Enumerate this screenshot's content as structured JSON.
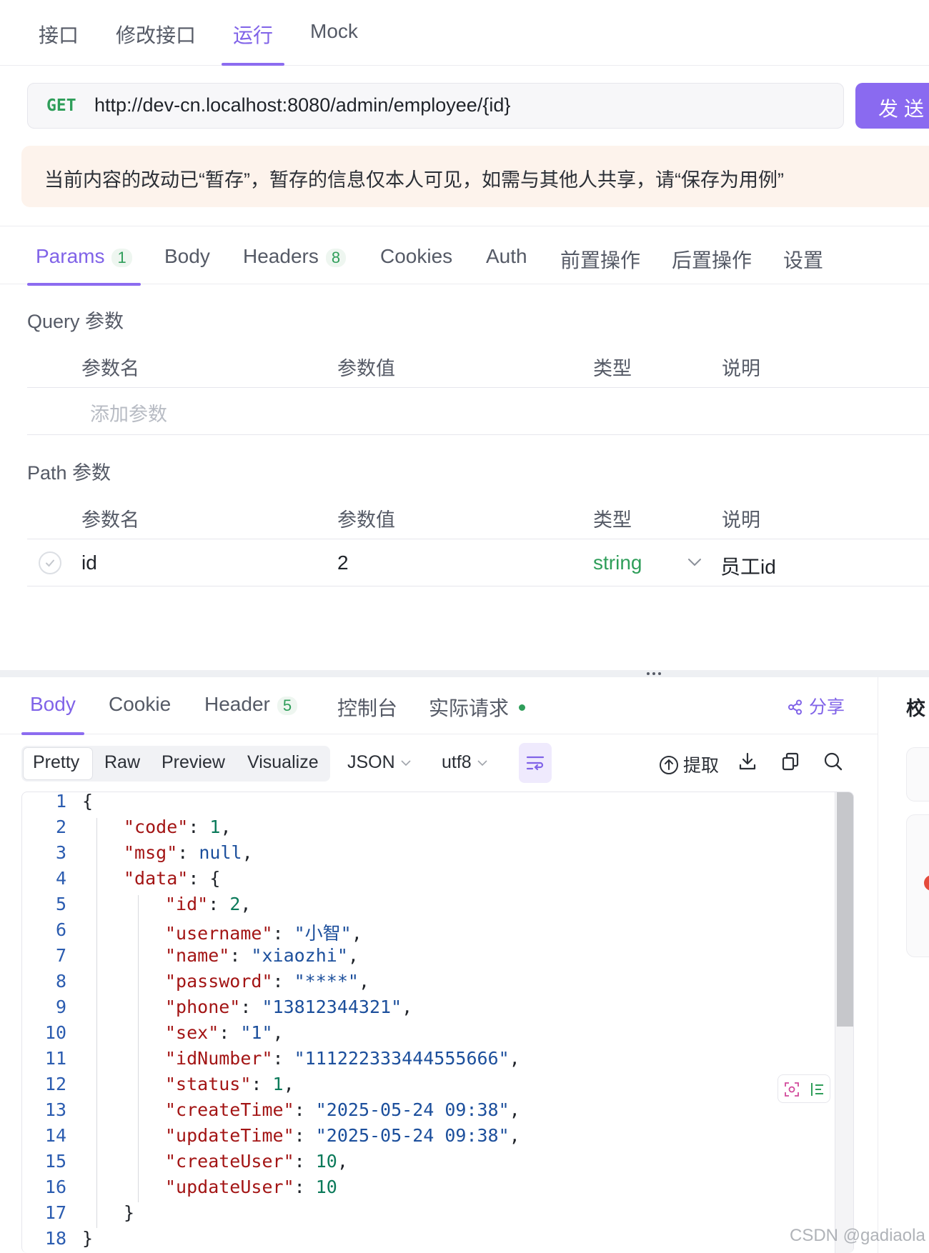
{
  "top_tabs": [
    {
      "label": "接口"
    },
    {
      "label": "修改接口"
    },
    {
      "label": "运行"
    },
    {
      "label": "Mock"
    }
  ],
  "request": {
    "method": "GET",
    "url": "http://dev-cn.localhost:8080/admin/employee/{id}",
    "send_label": "发送"
  },
  "notice": "当前内容的改动已“暂存”，暂存的信息仅本人可见，如需与其他人共享，请“保存为用例”",
  "request_tabs": [
    {
      "label": "Params",
      "count": "1"
    },
    {
      "label": "Body"
    },
    {
      "label": "Headers",
      "count": "8"
    },
    {
      "label": "Cookies"
    },
    {
      "label": "Auth"
    },
    {
      "label": "前置操作"
    },
    {
      "label": "后置操作"
    },
    {
      "label": "设置"
    }
  ],
  "query_section": {
    "title": "Query 参数",
    "columns": [
      "参数名",
      "参数值",
      "类型",
      "说明"
    ],
    "placeholder": "添加参数"
  },
  "path_section": {
    "title": "Path 参数",
    "columns": [
      "参数名",
      "参数值",
      "类型",
      "说明"
    ],
    "rows": [
      {
        "name": "id",
        "value": "2",
        "type": "string",
        "desc": "员工id"
      }
    ]
  },
  "response_tabs": [
    {
      "label": "Body"
    },
    {
      "label": "Cookie"
    },
    {
      "label": "Header",
      "count": "5"
    },
    {
      "label": "控制台"
    },
    {
      "label": "实际请求"
    }
  ],
  "share_label": "分享",
  "right_panel_label": "校",
  "toolbar": {
    "view_modes": [
      "Pretty",
      "Raw",
      "Preview",
      "Visualize"
    ],
    "format": "JSON",
    "encoding": "utf8",
    "extract_label": "提取"
  },
  "code_lines": [
    {
      "n": "1",
      "text": "{"
    },
    {
      "n": "2",
      "key": "code",
      "value": "1",
      "vtype": "number",
      "comma": ","
    },
    {
      "n": "3",
      "key": "msg",
      "value": "null",
      "vtype": "null",
      "comma": ","
    },
    {
      "n": "4",
      "key": "data",
      "value": "{",
      "vtype": "brace",
      "comma": ""
    },
    {
      "n": "5",
      "key": "id",
      "value": "2",
      "vtype": "number",
      "comma": ","
    },
    {
      "n": "6",
      "key": "username",
      "value": "小智",
      "vtype": "string",
      "comma": ","
    },
    {
      "n": "7",
      "key": "name",
      "value": "xiaozhi",
      "vtype": "string",
      "comma": ","
    },
    {
      "n": "8",
      "key": "password",
      "value": "****",
      "vtype": "string",
      "comma": ","
    },
    {
      "n": "9",
      "key": "phone",
      "value": "13812344321",
      "vtype": "string",
      "comma": ","
    },
    {
      "n": "10",
      "key": "sex",
      "value": "1",
      "vtype": "string",
      "comma": ","
    },
    {
      "n": "11",
      "key": "idNumber",
      "value": "111222333444555666",
      "vtype": "string",
      "comma": ","
    },
    {
      "n": "12",
      "key": "status",
      "value": "1",
      "vtype": "number",
      "comma": ","
    },
    {
      "n": "13",
      "key": "createTime",
      "value": "2025-05-24 09:38",
      "vtype": "string",
      "comma": ","
    },
    {
      "n": "14",
      "key": "updateTime",
      "value": "2025-05-24 09:38",
      "vtype": "string",
      "comma": ","
    },
    {
      "n": "15",
      "key": "createUser",
      "value": "10",
      "vtype": "number",
      "comma": ","
    },
    {
      "n": "16",
      "key": "updateUser",
      "value": "10",
      "vtype": "number",
      "comma": ""
    },
    {
      "n": "17",
      "text": "}"
    },
    {
      "n": "18",
      "text": "}"
    }
  ],
  "watermark": "CSDN @gadiaola",
  "colors": {
    "accent": "#8a6af0",
    "success": "#2f9e5a",
    "notice_bg": "#fdf3ec"
  }
}
